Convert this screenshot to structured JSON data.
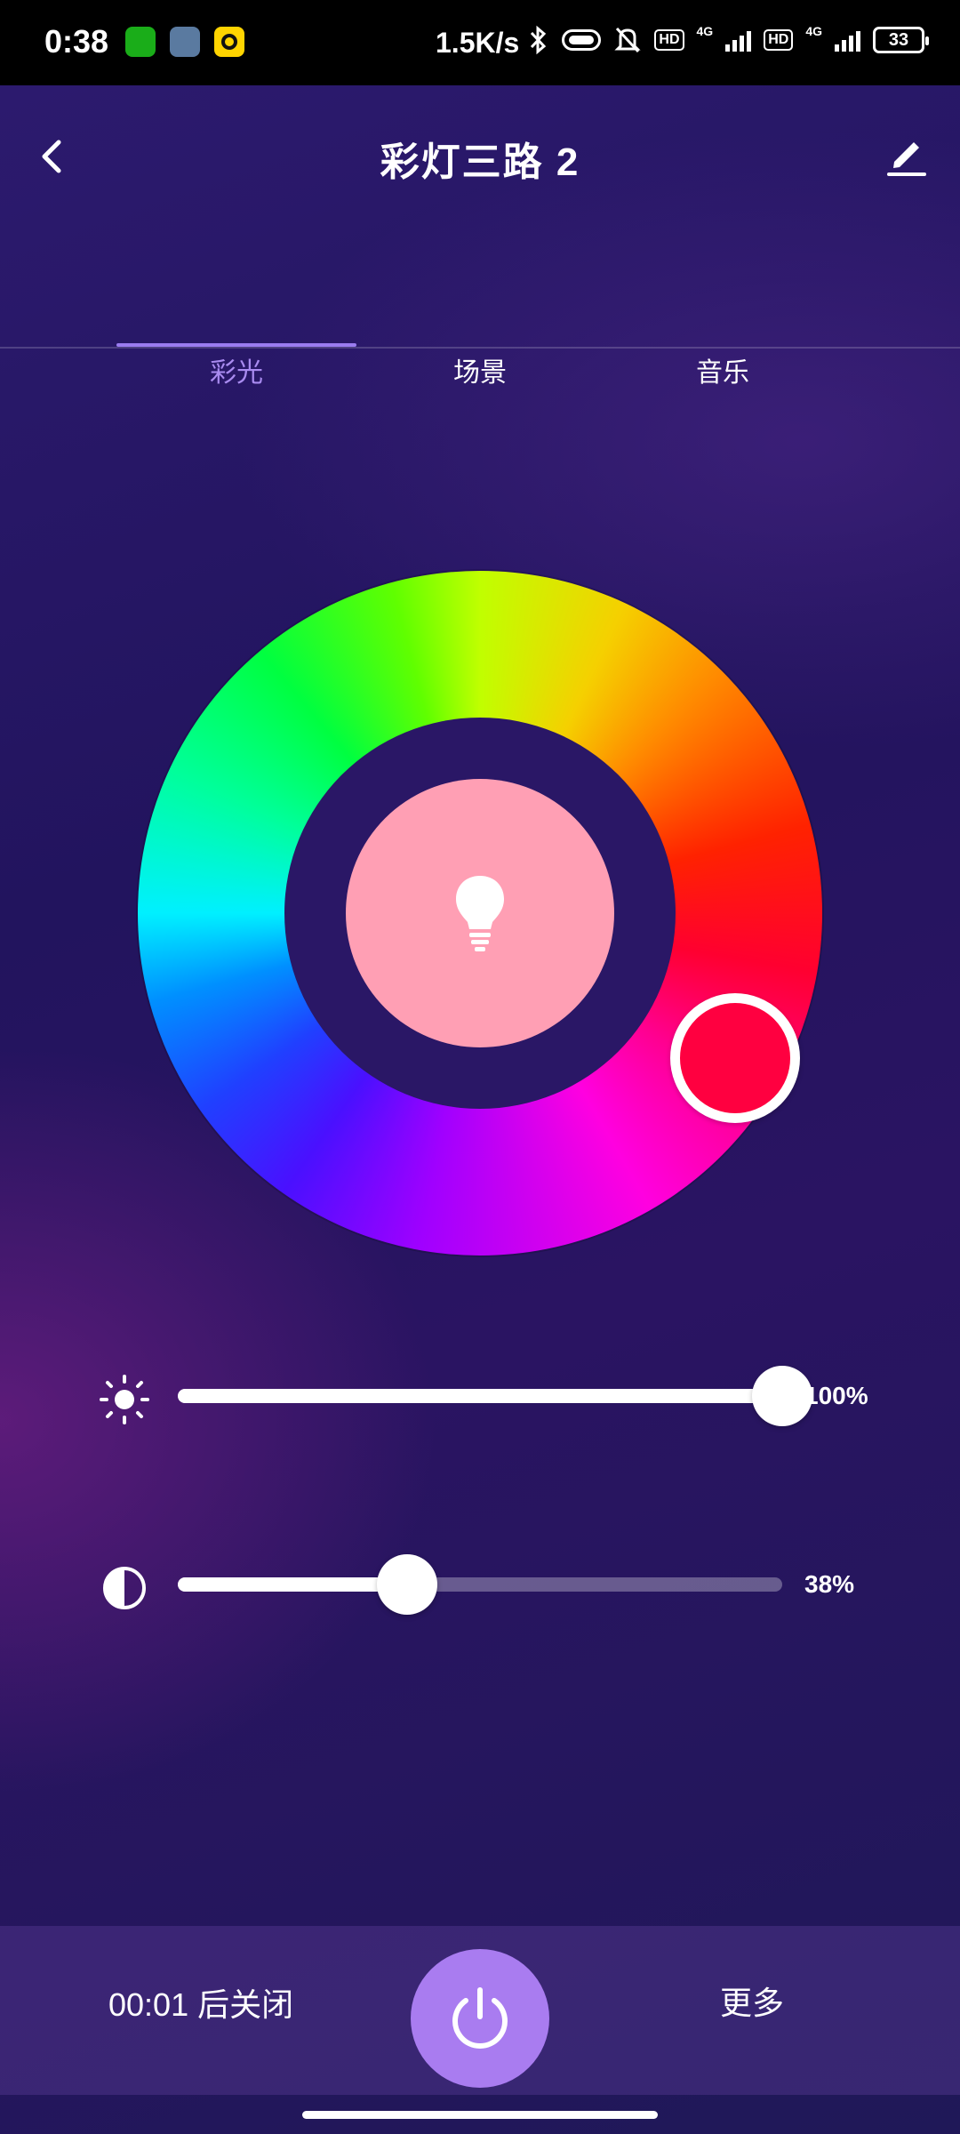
{
  "status_bar": {
    "time": "0:38",
    "net_speed": "1.5K/s",
    "hd1": "HD",
    "sig1": "4G",
    "hd2": "HD",
    "sig2": "4G",
    "battery": "33"
  },
  "header": {
    "title": "彩灯三路 2"
  },
  "tabs": [
    {
      "label": "彩光",
      "active": true
    },
    {
      "label": "场景",
      "active": false
    },
    {
      "label": "音乐",
      "active": false
    }
  ],
  "color_wheel": {
    "selected_color": "#ff0040",
    "preview_color": "#ff9fb4"
  },
  "brightness": {
    "value": 100,
    "label": "100%"
  },
  "contrast": {
    "value": 38,
    "label": "38%"
  },
  "bottom": {
    "timer": "00:01 后关闭",
    "more": "更多"
  },
  "colors": {
    "accent": "#a97cf0",
    "tab_active": "#a98bf0"
  }
}
